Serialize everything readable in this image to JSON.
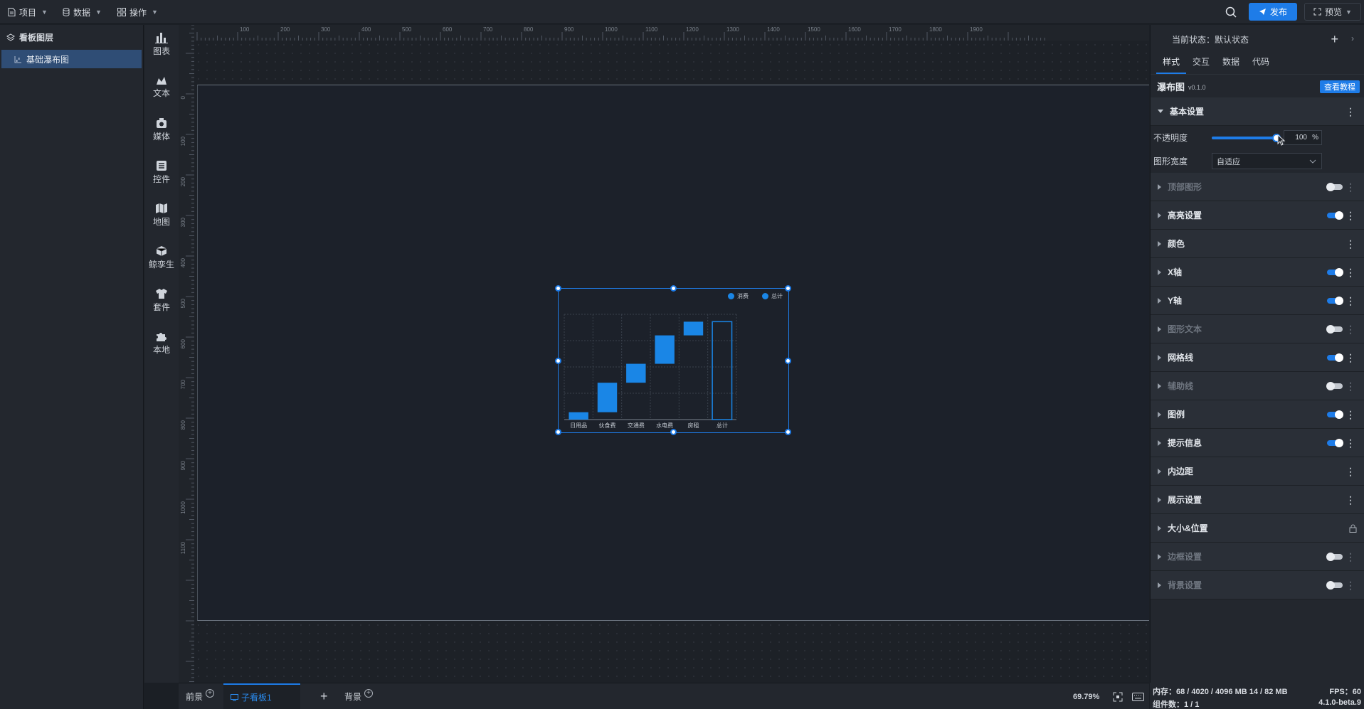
{
  "topbar": {
    "menus": [
      {
        "label": "项目",
        "icon": "file-icon"
      },
      {
        "label": "数据",
        "icon": "database-icon"
      },
      {
        "label": "操作",
        "icon": "grid-icon"
      }
    ],
    "publish_label": "发布",
    "preview_label": "预览"
  },
  "layers": {
    "title": "看板图层",
    "items": [
      {
        "label": "基础瀑布图",
        "icon": "waterfall-chart-icon"
      }
    ]
  },
  "tools": [
    {
      "label": "图表",
      "icon": "bar-chart-icon"
    },
    {
      "label": "文本",
      "icon": "text-icon"
    },
    {
      "label": "媒体",
      "icon": "media-icon"
    },
    {
      "label": "控件",
      "icon": "control-icon"
    },
    {
      "label": "地图",
      "icon": "map-icon"
    },
    {
      "label": "鲸孪生",
      "icon": "cube-icon"
    },
    {
      "label": "套件",
      "icon": "shirt-icon"
    },
    {
      "label": "本地",
      "icon": "puzzle-icon"
    }
  ],
  "rulers": {
    "top_ticks": [
      "100",
      "200",
      "300",
      "400",
      "500",
      "600",
      "700",
      "800",
      "900",
      "1000",
      "1100",
      "1200",
      "1300",
      "1400",
      "1500",
      "1600",
      "1700",
      "1800",
      "1900"
    ],
    "left_ticks": [
      "0",
      "100",
      "200",
      "300",
      "400",
      "500",
      "600",
      "700",
      "800",
      "900",
      "1000",
      "1100"
    ]
  },
  "bottombar": {
    "tabs": [
      {
        "label": "前景"
      },
      {
        "label": "子看板1",
        "active": true
      },
      {
        "label": "背景"
      }
    ],
    "zoom": "69.79%"
  },
  "status_footer": {
    "memory": "内存：68 / 4020 / 4096 MB  14 / 82 MB",
    "fps": "FPS：60",
    "components": "组件数：1 / 1",
    "version": "4.1.0-beta.9"
  },
  "panel": {
    "state_label": "当前状态：默认状态",
    "tabs": [
      "样式",
      "交互",
      "数据",
      "代码"
    ],
    "active_tab": "样式",
    "component_name": "瀑布图",
    "component_version": "v0.1.0",
    "tutorial_label": "查看教程",
    "basic_section": "基本设置",
    "opacity_label": "不透明度",
    "opacity_value": "100",
    "opacity_unit": "%",
    "opacity_fraction": 1.0,
    "width_label": "图形宽度",
    "width_value": "自适应",
    "sections": [
      {
        "label": "顶部图形",
        "toggle": "off",
        "disabled": true
      },
      {
        "label": "高亮设置",
        "toggle": "on",
        "disabled": false
      },
      {
        "label": "颜色",
        "toggle": null,
        "disabled": false
      },
      {
        "label": "X轴",
        "toggle": "on",
        "disabled": false
      },
      {
        "label": "Y轴",
        "toggle": "on",
        "disabled": false
      },
      {
        "label": "图形文本",
        "toggle": "off",
        "disabled": true
      },
      {
        "label": "网格线",
        "toggle": "on",
        "disabled": false
      },
      {
        "label": "辅助线",
        "toggle": "off",
        "disabled": true
      },
      {
        "label": "图例",
        "toggle": "on",
        "disabled": false
      },
      {
        "label": "提示信息",
        "toggle": "on",
        "disabled": false
      },
      {
        "label": "内边距",
        "toggle": null,
        "disabled": false
      },
      {
        "label": "展示设置",
        "toggle": null,
        "disabled": false
      },
      {
        "label": "大小&位置",
        "toggle": "lock",
        "disabled": false
      },
      {
        "label": "边框设置",
        "toggle": "off",
        "disabled": true
      },
      {
        "label": "背景设置",
        "toggle": "off",
        "disabled": true
      }
    ]
  },
  "colors": {
    "accent": "#1e7ce8",
    "bar": "#1a86e6",
    "panel_bg": "#23272e",
    "canvas_bg": "#1c212a"
  },
  "chart_data": {
    "type": "bar",
    "subtype": "waterfall",
    "legend": [
      "消费",
      "总计"
    ],
    "legend_position": "top-right",
    "categories": [
      "日用品",
      "伙食费",
      "交通费",
      "水电费",
      "房租",
      "总计"
    ],
    "floating_bars": [
      {
        "category": "日用品",
        "start": 0,
        "end": 7
      },
      {
        "category": "伙食费",
        "start": 7,
        "end": 35
      },
      {
        "category": "交通费",
        "start": 35,
        "end": 53
      },
      {
        "category": "水电费",
        "start": 53,
        "end": 80
      },
      {
        "category": "房租",
        "start": 80,
        "end": 93
      }
    ],
    "total": {
      "category": "总计",
      "value": 93
    },
    "ylim": [
      0,
      100
    ],
    "grid": true
  }
}
